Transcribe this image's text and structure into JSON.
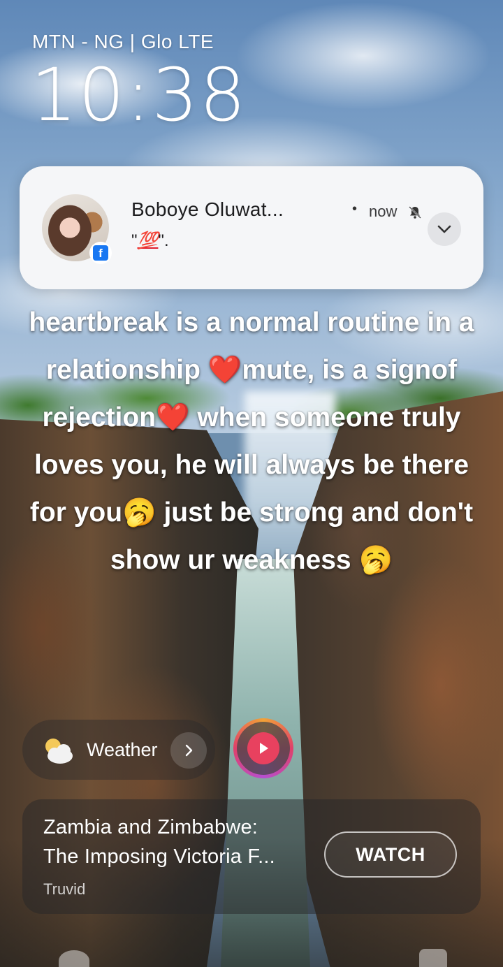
{
  "status_bar": {
    "carrier": "MTN - NG | Glo LTE",
    "time": "10:38"
  },
  "notification": {
    "app_icon": "facebook-icon",
    "sender": "Boboye Oluwat...",
    "separator": "•",
    "time": "now",
    "status_icon": "bell-muted-icon",
    "message_open_quote": "\"",
    "message_emoji": "💯",
    "message_close": "\".",
    "expand_icon": "chevron-down-icon"
  },
  "overlay_text": "heartbreak is a normal routine in a relationship ❤️mute, is a signof rejection❤️ when someone truly loves you, he will always be there for you🥱 just be strong and don't show ur weakness 🥱",
  "weather": {
    "icon": "partly-cloudy-icon",
    "label": "Weather",
    "chevron_icon": "chevron-right-icon"
  },
  "play_button": {
    "icon": "play-icon"
  },
  "video_card": {
    "title_line_1": "Zambia and Zimbabwe:",
    "title_line_2": "The Imposing Victoria F...",
    "source": "Truvid",
    "action_label": "WATCH"
  },
  "colors": {
    "card_background": "#f5f6f8",
    "facebook_blue": "#1877f2",
    "play_red": "#e8415f"
  }
}
